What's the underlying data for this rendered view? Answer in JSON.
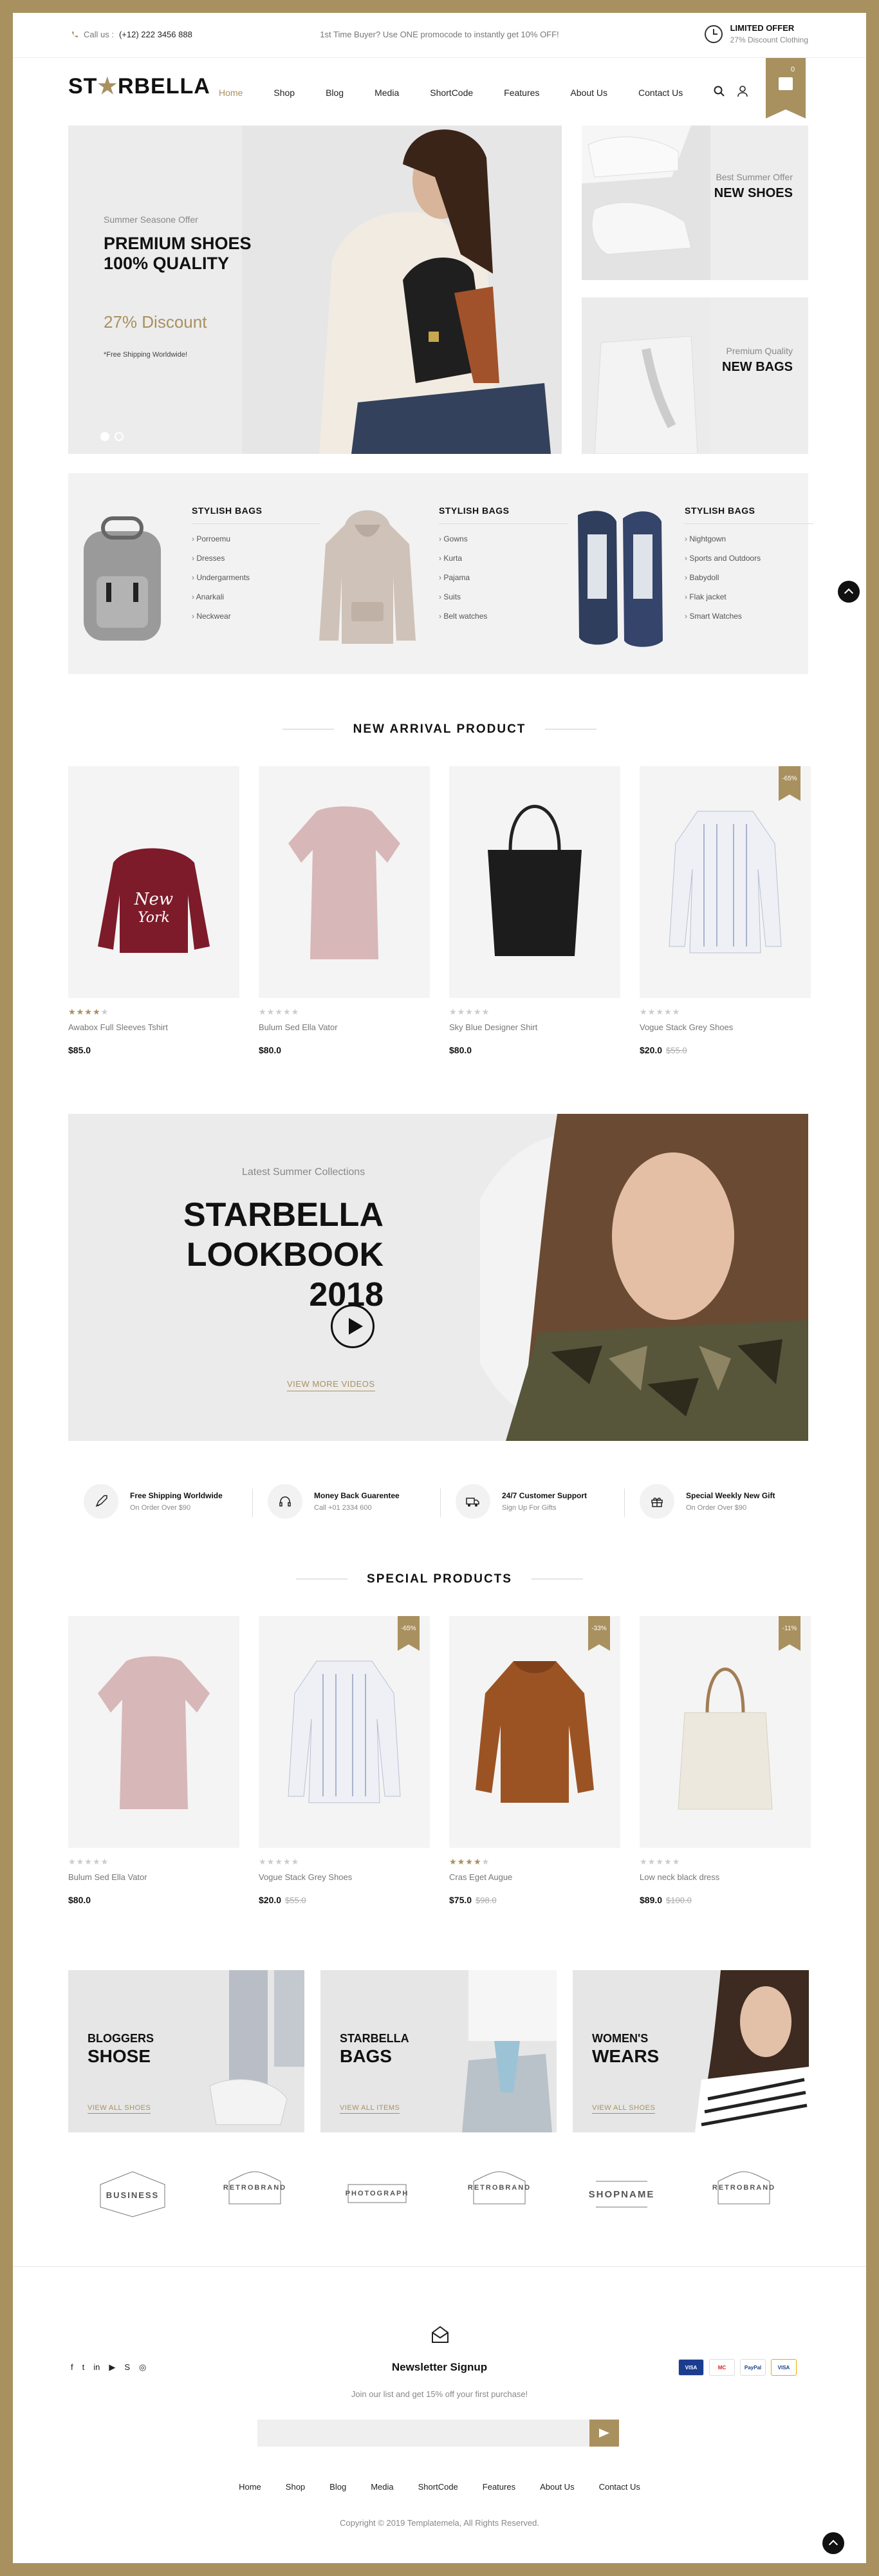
{
  "topbar": {
    "phone_label": "Call us :",
    "phone": "(+12) 222 3456 888",
    "promo": "1st Time Buyer? Use ONE promocode to instantly get 10% OFF!",
    "offer_title": "LIMITED OFFER",
    "offer_sub": "27% Discount Clothing"
  },
  "header": {
    "logo_a": "ST",
    "logo_b": "RBELLA",
    "nav": [
      "Home",
      "Shop",
      "Blog",
      "Media",
      "ShortCode",
      "Features",
      "About Us",
      "Contact Us"
    ],
    "cart_count": "0"
  },
  "hero": {
    "small": "Summer Seasone Offer",
    "title1": "PREMIUM SHOES",
    "title2": "100% QUALITY",
    "discount": "27% Discount",
    "note": "*Free Shipping Worldwide!"
  },
  "side1": {
    "small": "Best Summer Offer",
    "big": "NEW SHOES"
  },
  "side2": {
    "small": "Premium Quality",
    "big": "NEW BAGS"
  },
  "categories": [
    {
      "title": "STYLISH BAGS",
      "items": [
        "Porroemu",
        "Dresses",
        "Undergarments",
        "Anarkali",
        "Neckwear"
      ]
    },
    {
      "title": "STYLISH BAGS",
      "items": [
        "Gowns",
        "Kurta",
        "Pajama",
        "Suits",
        "Belt watches"
      ]
    },
    {
      "title": "STYLISH BAGS",
      "items": [
        "Nightgown",
        "Sports and Outdoors",
        "Babydoll",
        "Flak jacket",
        "Smart Watches"
      ]
    }
  ],
  "new_arrival": {
    "title": "NEW ARRIVAL PRODUCT",
    "products": [
      {
        "name": "Awabox Full Sleeves Tshirt",
        "price": "$85.0",
        "old": "",
        "badge": "",
        "rating": 4
      },
      {
        "name": "Bulum Sed Ella Vator",
        "price": "$80.0",
        "old": "",
        "badge": "",
        "rating": 0
      },
      {
        "name": "Sky Blue Designer Shirt",
        "price": "$80.0",
        "old": "",
        "badge": "",
        "rating": 0
      },
      {
        "name": "Vogue Stack Grey Shoes",
        "price": "$20.0",
        "old": "$55.0",
        "badge": "-65%",
        "rating": 0
      }
    ]
  },
  "banner": {
    "sub": "Latest Summer Collections",
    "title1": "STARBELLA",
    "title2": "LOOKBOOK 2018",
    "link": "VIEW MORE VIDEOS"
  },
  "features": [
    {
      "title": "Free Shipping Worldwide",
      "desc": "On Order Over $90"
    },
    {
      "title": "Money Back Guarentee",
      "desc": "Call +01 2334 600"
    },
    {
      "title": "24/7 Customer Support",
      "desc": "Sign Up For Gifts"
    },
    {
      "title": "Special Weekly New Gift",
      "desc": "On Order Over $90"
    }
  ],
  "special": {
    "title": "SPECIAL PRODUCTS",
    "products": [
      {
        "name": "Bulum Sed Ella Vator",
        "price": "$80.0",
        "old": "",
        "badge": "",
        "rating": 0
      },
      {
        "name": "Vogue Stack Grey Shoes",
        "price": "$20.0",
        "old": "$55.0",
        "badge": "-65%",
        "rating": 0
      },
      {
        "name": "Cras Eget Augue",
        "price": "$75.0",
        "old": "$98.0",
        "badge": "-33%",
        "rating": 4
      },
      {
        "name": "Low neck black dress",
        "price": "$89.0",
        "old": "$100.0",
        "badge": "-11%",
        "rating": 0
      }
    ]
  },
  "promos": [
    {
      "t1": "BLOGGERS",
      "t2": "SHOSE",
      "link": "VIEW ALL SHOES"
    },
    {
      "t1": "STARBELLA",
      "t2": "BAGS",
      "link": "VIEW ALL ITEMS"
    },
    {
      "t1": "WOMEN'S",
      "t2": "WEARS",
      "link": "VIEW ALL SHOES"
    }
  ],
  "brands": [
    "BUSINESS",
    "RETROBRAND",
    "PHOTOGRAPH",
    "RETROBRAND",
    "SHOPNAME",
    "RETROBRAND"
  ],
  "footer": {
    "nl_title": "Newsletter Signup",
    "nl_sub": "Join our list and get 15% off your first purchase!",
    "nav": [
      "Home",
      "Shop",
      "Blog",
      "Media",
      "ShortCode",
      "Features",
      "About Us",
      "Contact Us"
    ],
    "copyright": "Copyright © 2019 Templatemela, All Rights Reserved.",
    "payments": [
      "VISA",
      "MC",
      "PayPal",
      "VISA"
    ]
  },
  "colors": {
    "accent": "#a9905f",
    "frame": "#a9905f"
  }
}
